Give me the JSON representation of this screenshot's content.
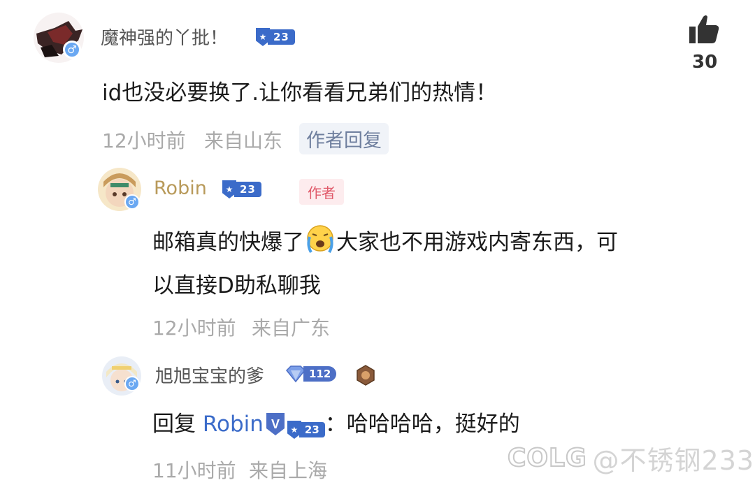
{
  "comment": {
    "username": "魔神强的丫批！",
    "level": "23",
    "likes": "30",
    "text": "id也没必要换了.让你看看兄弟们的热情！",
    "time": "12小时前",
    "location": "来自山东",
    "author_reply_tag": "作者回复"
  },
  "reply1": {
    "username": "Robin",
    "level": "23",
    "author_tag": "作者",
    "text_line1_a": "邮箱真的快爆了",
    "text_line1_b": "大家也不用游戏内寄东西，可",
    "text_line2": "以直接D助私聊我",
    "time": "12小时前",
    "location": "来自广东"
  },
  "reply2": {
    "username": "旭旭宝宝的爹",
    "level": "112",
    "reply_prefix": "回复",
    "reply_target": "Robin",
    "target_level": "23",
    "text": "：哈哈哈哈，挺好的",
    "time": "11小时前",
    "location": "来自上海"
  },
  "watermark": {
    "brand": "COLG",
    "handle": "@不锈钢233"
  },
  "colors": {
    "badge_blue": "#3b6bc9",
    "gender_blue": "#6aa8f2",
    "author_red": "#e05a6a",
    "robin_gold": "#b89a5a"
  }
}
